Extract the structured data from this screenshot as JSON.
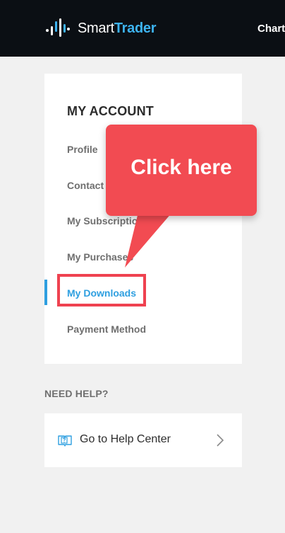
{
  "header": {
    "brand_part1": "Smart",
    "brand_part2": "Trader",
    "nav_item": "Chart"
  },
  "account": {
    "title": "MY ACCOUNT",
    "items": [
      {
        "label": "Profile",
        "active": false
      },
      {
        "label": "Contact",
        "active": false
      },
      {
        "label": "My Subscriptio",
        "active": false
      },
      {
        "label": "My Purchases",
        "active": false
      },
      {
        "label": "My Downloads",
        "active": true
      },
      {
        "label": "Payment Method",
        "active": false
      }
    ]
  },
  "help": {
    "heading": "NEED HELP?",
    "link_label": "Go to Help Center",
    "icon": "book-question-icon"
  },
  "callout": {
    "text": "Click here"
  },
  "colors": {
    "topbar": "#0b0f14",
    "accent": "#2e9fe0",
    "callout": "#f24b52",
    "highlight": "#ef4250"
  }
}
